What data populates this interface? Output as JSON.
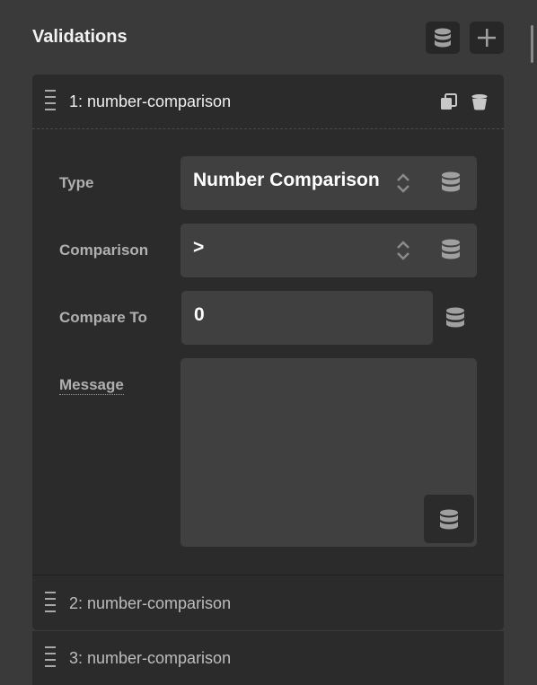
{
  "header": {
    "title": "Validations",
    "dynamic_icon": "database-icon",
    "add_icon": "plus-icon"
  },
  "validations": [
    {
      "title": "1: number-comparison",
      "expanded": true,
      "fields": {
        "type": {
          "label": "Type",
          "value": "Number Comparison"
        },
        "comparison": {
          "label": "Comparison",
          "value": ">"
        },
        "compare_to": {
          "label": "Compare To",
          "value": "0"
        },
        "message": {
          "label": "Message",
          "value": ""
        }
      }
    },
    {
      "title": "2: number-comparison",
      "expanded": false
    },
    {
      "title": "3: number-comparison",
      "expanded": false
    }
  ],
  "colors": {
    "background": "#3a3a3a",
    "card": "#2b2b2b",
    "field": "#404040",
    "icon": "#a0a0a0"
  }
}
